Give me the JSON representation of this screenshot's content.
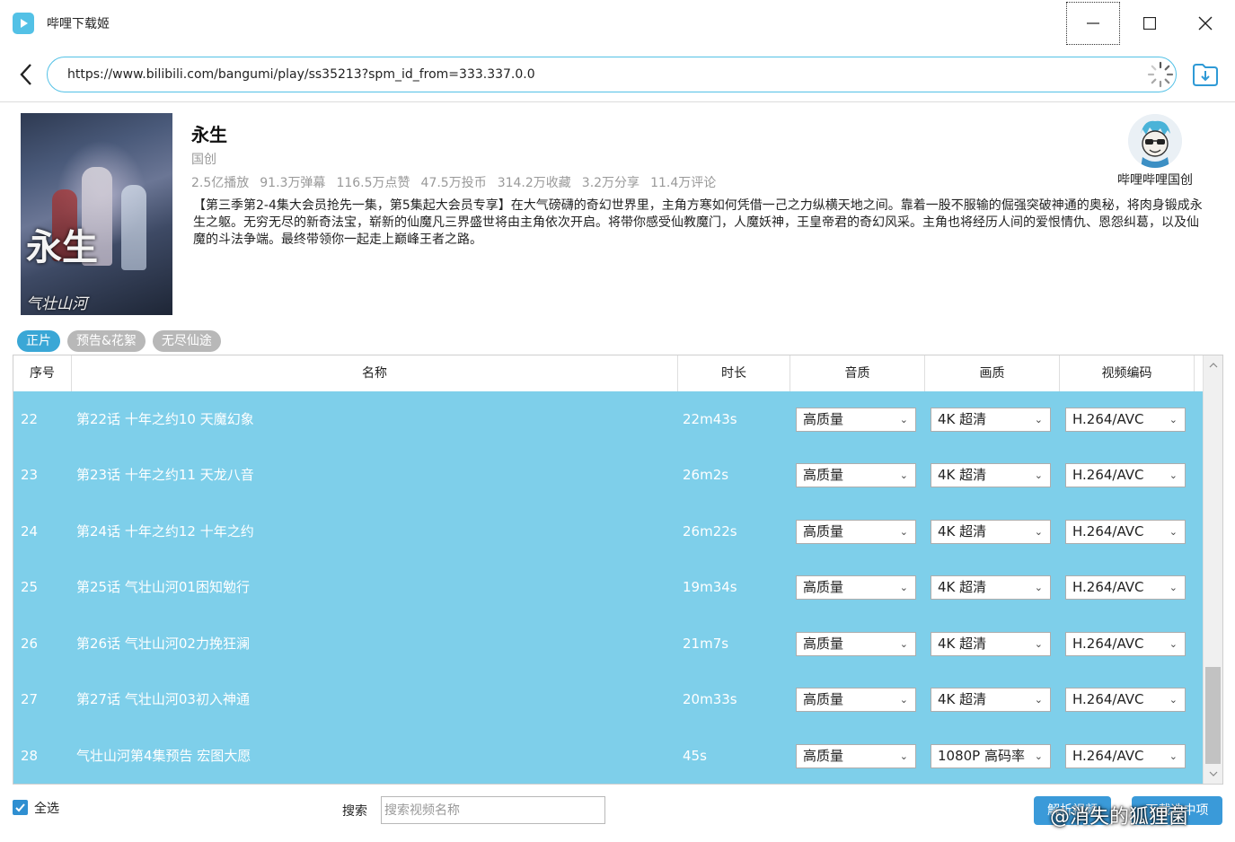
{
  "window": {
    "title": "哔哩下载姬"
  },
  "url": {
    "value": "https://www.bilibili.com/bangumi/play/ss35213?spm_id_from=333.337.0.0"
  },
  "info": {
    "title": "永生",
    "category": "国创",
    "stats": [
      "2.5亿播放",
      "91.3万弹幕",
      "116.5万点赞",
      "47.5万投币",
      "314.2万收藏",
      "3.2万分享",
      "11.4万评论"
    ],
    "description": "【第三季第2-4集大会员抢先一集，第5集起大会员专享】在大气磅礴的奇幻世界里，主角方寒如何凭借一己之力纵横天地之间。靠着一股不服输的倔强突破神通的奥秘，将肉身锻成永生之躯。无穷无尽的新奇法宝，崭新的仙魔凡三界盛世将由主角依次开启。将带你感受仙教魔门，人魔妖神，王皇帝君的奇幻风采。主角也将经历人间的爱恨情仇、恩怨纠葛，以及仙魔的斗法争端。最终带领你一起走上巅峰王者之路。",
    "cover_text": "永生",
    "cover_subtext": "气壮山河",
    "uploader": "哔哩哔哩国创"
  },
  "tabs": [
    {
      "label": "正片",
      "active": true
    },
    {
      "label": "预告&花絮",
      "active": false
    },
    {
      "label": "无尽仙途",
      "active": false
    }
  ],
  "table": {
    "headers": {
      "no": "序号",
      "name": "名称",
      "duration": "时长",
      "audio": "音质",
      "video": "画质",
      "codec": "视频编码"
    },
    "rows": [
      {
        "no": "22",
        "name": "第22话 十年之约10 天魔幻象",
        "duration": "22m43s",
        "audio": "高质量",
        "video": "4K 超清",
        "codec": "H.264/AVC"
      },
      {
        "no": "23",
        "name": "第23话 十年之约11 天龙八音",
        "duration": "26m2s",
        "audio": "高质量",
        "video": "4K 超清",
        "codec": "H.264/AVC"
      },
      {
        "no": "24",
        "name": "第24话 十年之约12 十年之约",
        "duration": "26m22s",
        "audio": "高质量",
        "video": "4K 超清",
        "codec": "H.264/AVC"
      },
      {
        "no": "25",
        "name": "第25话 气壮山河01困知勉行",
        "duration": "19m34s",
        "audio": "高质量",
        "video": "4K 超清",
        "codec": "H.264/AVC"
      },
      {
        "no": "26",
        "name": "第26话 气壮山河02力挽狂澜",
        "duration": "21m7s",
        "audio": "高质量",
        "video": "4K 超清",
        "codec": "H.264/AVC"
      },
      {
        "no": "27",
        "name": "第27话 气壮山河03初入神通",
        "duration": "20m33s",
        "audio": "高质量",
        "video": "4K 超清",
        "codec": "H.264/AVC"
      },
      {
        "no": "28",
        "name": "气壮山河第4集预告 宏图大愿",
        "duration": "45s",
        "audio": "高质量",
        "video": "1080P 高码率",
        "codec": "H.264/AVC"
      }
    ]
  },
  "bottom": {
    "select_all": "全选",
    "search_label": "搜索",
    "search_placeholder": "搜索视频名称",
    "parse_button": "解析视频",
    "download_button": "下载选中项"
  },
  "watermark": "@消失的狐狸菌",
  "colors": {
    "accent": "#53c1e6",
    "row_selected": "#7ecfea",
    "button": "#3a9ad9"
  },
  "icons": {
    "app": "play-logo-icon",
    "back": "chevron-left-icon",
    "loading": "spinner-icon",
    "download": "folder-download-icon",
    "checkbox": "check-icon",
    "dropdown": "chevron-down-icon"
  }
}
